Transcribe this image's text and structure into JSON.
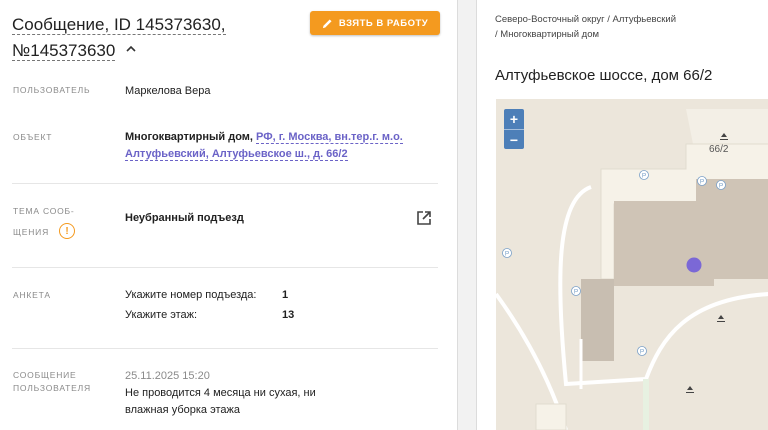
{
  "header": {
    "title_line1": "Сообщение, ID 145373630,",
    "title_line2": "№145373630",
    "take_button": "ВЗЯТЬ В РАБОТУ"
  },
  "fields": {
    "user_label": "ПОЛЬЗОВАТЕЛЬ",
    "user_value": "Маркелова Вера",
    "object_label": "ОБЪЕКТ",
    "object_type": "Многоквартирный дом,",
    "object_address": "РФ, г. Москва, вн.тер.г. м.о. Алтуфьевский, Алтуфьевское ш., д. 66/2",
    "topic_label_line1": "ТЕМА СООБ-",
    "topic_label_line2": "ЩЕНИЯ",
    "topic_value": "Неубранный подъезд",
    "survey_label": "АНКЕТА",
    "survey": [
      {
        "question": "Укажите номер подъезда:",
        "answer": "1"
      },
      {
        "question": "Укажите этаж:",
        "answer": "13"
      }
    ],
    "message_label_line1": "СООБЩЕНИЕ",
    "message_label_line2": "ПОЛЬЗОВАТЕЛЯ",
    "message_date": "25.11.2025 15:20",
    "message_text": "Не проводится 4 месяца ни сухая, ни влажная уборка этажа"
  },
  "right": {
    "breadcrumb_line1": "Северо-Восточный округ / Алтуфьевский",
    "breadcrumb_line2": "/ Многоквартирный дом",
    "address_title": "Алтуфьевское шоссе, дом 66/2",
    "map": {
      "zoom_in": "+",
      "zoom_out": "−",
      "building_label": "66/2",
      "parking_label": "P"
    }
  },
  "colors": {
    "accent": "#f49a1f",
    "link": "#6b63c7",
    "zoom": "#4d7fb8",
    "marker": "#7b68d6"
  },
  "icons": [
    "pencil-icon",
    "chevron-up-icon",
    "warning-icon",
    "external-link-icon",
    "parking-icon",
    "entrance-icon"
  ]
}
